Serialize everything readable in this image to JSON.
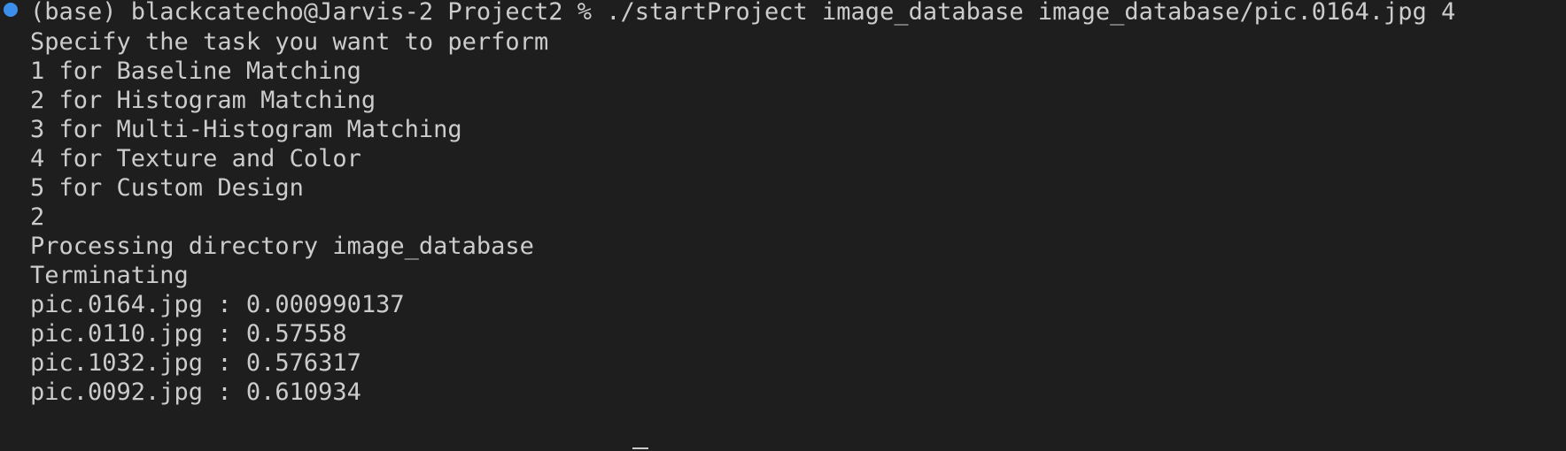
{
  "terminal": {
    "prompt_line": "(base) blackcatecho@Jarvis-2 Project2 % ./startProject image_database image_database/pic.0164.jpg 4",
    "lines": [
      "Specify the task you want to perform",
      "1 for Baseline Matching",
      "2 for Histogram Matching",
      "3 for Multi-Histogram Matching",
      "4 for Texture and Color",
      "5 for Custom Design",
      "2",
      "Processing directory image_database",
      "Terminating",
      "pic.0164.jpg : 0.000990137",
      "pic.0110.jpg : 0.57558",
      "pic.1032.jpg : 0.576317",
      "pic.0092.jpg : 0.610934"
    ],
    "marker_color": "#3b8eea"
  }
}
